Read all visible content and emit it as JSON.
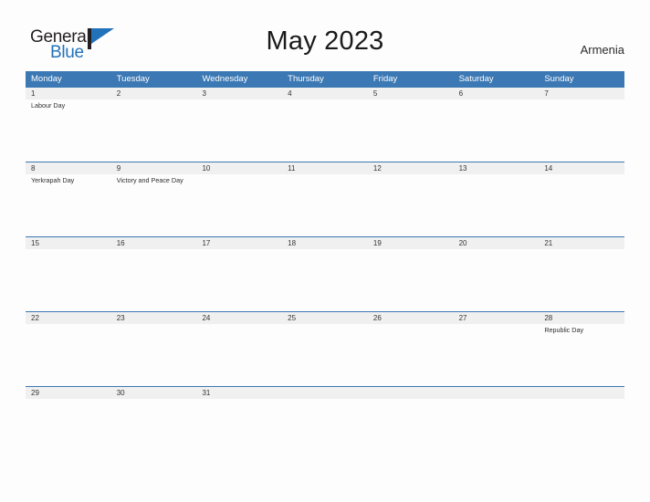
{
  "logo": {
    "word_one": "General",
    "word_two": "Blue",
    "flag_icon": "blue-flag-triangle-icon"
  },
  "header": {
    "title": "May 2023",
    "country": "Armenia"
  },
  "colors": {
    "header_blue": "#3b78b4",
    "logo_blue": "#2272b9",
    "date_band_gray": "#f0f0f0",
    "text_dark": "#2f2f2f"
  },
  "calendar": {
    "weekdays": [
      "Monday",
      "Tuesday",
      "Wednesday",
      "Thursday",
      "Friday",
      "Saturday",
      "Sunday"
    ],
    "weeks": [
      {
        "days": [
          {
            "date": "1",
            "event": "Labour Day"
          },
          {
            "date": "2",
            "event": ""
          },
          {
            "date": "3",
            "event": ""
          },
          {
            "date": "4",
            "event": ""
          },
          {
            "date": "5",
            "event": ""
          },
          {
            "date": "6",
            "event": ""
          },
          {
            "date": "7",
            "event": ""
          }
        ]
      },
      {
        "days": [
          {
            "date": "8",
            "event": "Yerkrapah Day"
          },
          {
            "date": "9",
            "event": "Victory and Peace Day"
          },
          {
            "date": "10",
            "event": ""
          },
          {
            "date": "11",
            "event": ""
          },
          {
            "date": "12",
            "event": ""
          },
          {
            "date": "13",
            "event": ""
          },
          {
            "date": "14",
            "event": ""
          }
        ]
      },
      {
        "days": [
          {
            "date": "15",
            "event": ""
          },
          {
            "date": "16",
            "event": ""
          },
          {
            "date": "17",
            "event": ""
          },
          {
            "date": "18",
            "event": ""
          },
          {
            "date": "19",
            "event": ""
          },
          {
            "date": "20",
            "event": ""
          },
          {
            "date": "21",
            "event": ""
          }
        ]
      },
      {
        "days": [
          {
            "date": "22",
            "event": ""
          },
          {
            "date": "23",
            "event": ""
          },
          {
            "date": "24",
            "event": ""
          },
          {
            "date": "25",
            "event": ""
          },
          {
            "date": "26",
            "event": ""
          },
          {
            "date": "27",
            "event": ""
          },
          {
            "date": "28",
            "event": "Republic Day"
          }
        ]
      },
      {
        "days": [
          {
            "date": "29",
            "event": ""
          },
          {
            "date": "30",
            "event": ""
          },
          {
            "date": "31",
            "event": ""
          },
          {
            "date": "",
            "event": ""
          },
          {
            "date": "",
            "event": ""
          },
          {
            "date": "",
            "event": ""
          },
          {
            "date": "",
            "event": ""
          }
        ]
      }
    ]
  }
}
